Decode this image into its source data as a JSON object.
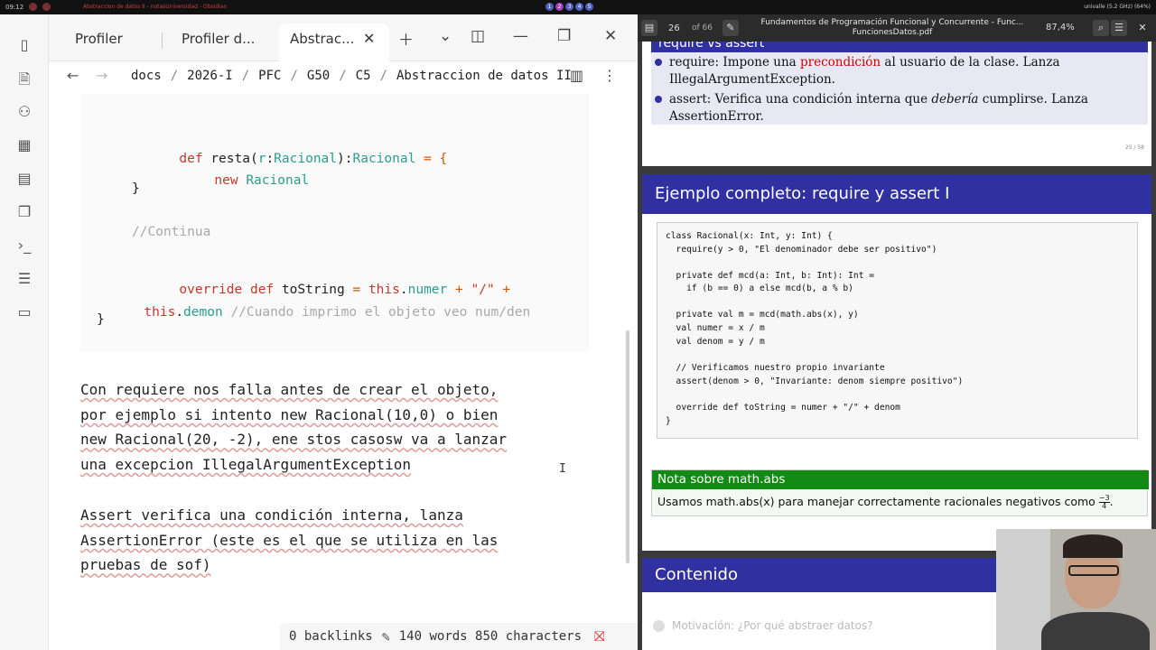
{
  "sysbar": {
    "time": "09:12",
    "title": "Abstraccion de datos II - notasUniversidad - Obsidian",
    "workspaces": [
      "1",
      "2",
      "3",
      "4",
      "5"
    ],
    "right_info": "univalle (5.2 GHz) (64%)"
  },
  "obsidian": {
    "tabs": [
      {
        "label": "Profiler"
      },
      {
        "label": "Profiler d..."
      },
      {
        "label": "Abstrac..."
      }
    ],
    "breadcrumbs": [
      "docs",
      "2026-I",
      "PFC",
      "G50",
      "C5",
      "Abstraccion de datos II"
    ],
    "code": {
      "line1_kw": "def",
      "line1_name": " resta(",
      "line1_param": "r",
      "line1_colon": ":",
      "line1_type": "Racional",
      "line1_close": "):",
      "line1_ret": "Racional",
      "line1_eq": " = {",
      "line2_kw": "new",
      "line2_type": "Racional",
      "line3": "}",
      "line4": "//Continua",
      "line5_kw1": "override",
      "line5_kw2": "def",
      "line5_name": "toString",
      "line5_eq": "=",
      "line5_this": "this",
      "line5_field": "numer",
      "line5_plus": "+",
      "line5_str": "\"/\"",
      "line5_plus2": "+",
      "line6_this": "this",
      "line6_field": "demon",
      "line6_comment": "//Cuando imprimo el objeto veo num/den",
      "line7": "}"
    },
    "paragraph1": [
      "Con requiere nos falla antes de crear el objeto,",
      "por ejemplo si intento new Racional(10,0) o bien",
      "new Racional(20, -2), ene stos casosw va a lanzar",
      "una excepcion IllegalArgumentException"
    ],
    "paragraph2": [
      "Assert verifica una condición interna, lanza",
      "AssertionError (este es el que se utiliza en las",
      "pruebas de sof)"
    ],
    "status": {
      "backlinks": "0 backlinks",
      "counts": "140 words 850 characters"
    }
  },
  "pdf": {
    "page": "26",
    "page_of": "of 66",
    "title_line1": "Fundamentos de Programación Funcional y Concurrente - Func...",
    "title_line2": "FuncionesDatos.pdf",
    "zoom": "87,4%",
    "slide1": {
      "header": "require vs assert",
      "b1_a": "require: Impone una ",
      "b1_red": "precondición",
      "b1_b": " al usuario de la clase. Lanza",
      "b1_c": "IllegalArgumentException.",
      "b2_a": "assert: Verifica una condición interna que ",
      "b2_em": "debería",
      "b2_b": " cumplirse. Lanza",
      "b2_c": "AssertionError.",
      "pagenum": "25 / 58"
    },
    "slide2": {
      "title": "Ejemplo completo: require y assert I",
      "code": [
        "class Racional(x: Int, y: Int) {",
        "  require(y > 0, \"El denominador debe ser positivo\")",
        "",
        "  private def mcd(a: Int, b: Int): Int =",
        "    if (b == 0) a else mcd(b, a % b)",
        "",
        "  private val m = mcd(math.abs(x), y)",
        "  val numer = x / m",
        "  val denom = y / m",
        "",
        "  // Verificamos nuestro propio invariante",
        "  assert(denom > 0, \"Invariante: denom siempre positivo\")",
        "",
        "  override def toString = numer + \"/\" + denom",
        "}"
      ],
      "note_title": "Nota sobre math.abs",
      "note_body": "Usamos math.abs(x) para manejar correctamente racionales negativos como",
      "note_frac_num": "−3",
      "note_frac_den": "4"
    },
    "slide3": {
      "title": "Contenido",
      "toc_item": "Motivación: ¿Por qué abstraer datos?"
    }
  }
}
